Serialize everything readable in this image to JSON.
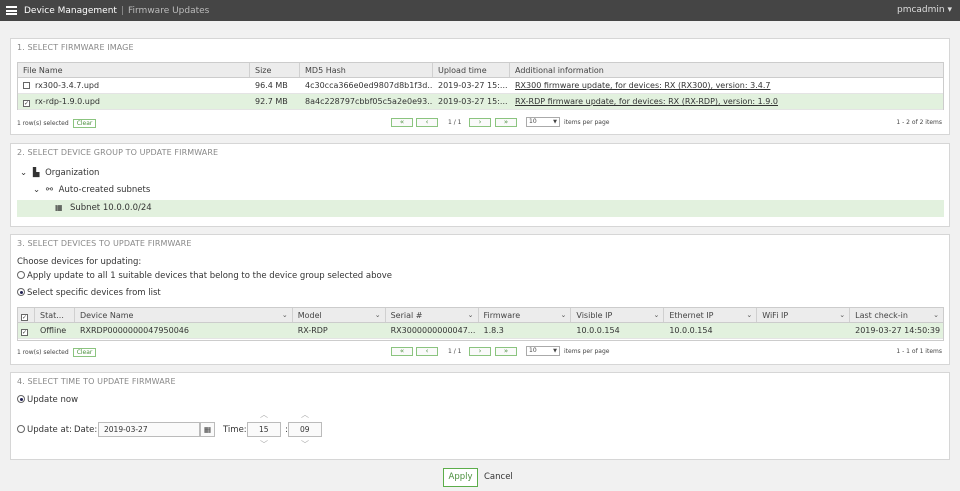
{
  "topbar": {
    "title": "Device Management",
    "separator": "|",
    "subtitle": "Firmware Updates",
    "user": "pmcadmin ▾"
  },
  "section1": {
    "title": "1. SELECT FIRMWARE IMAGE",
    "columns": [
      "File Name",
      "Size",
      "MD5 Hash",
      "Upload time",
      "Additional information"
    ],
    "rows": [
      {
        "name": "rx300-3.4.7.upd",
        "size": "96.4 MB",
        "md5": "4c30cca366e0ed9807d8b1f3d...",
        "time": "2019-03-27 15:...",
        "info": "RX300 firmware update, for devices: RX (RX300), version: 3.4.7",
        "selected": false
      },
      {
        "name": "rx-rdp-1.9.0.upd",
        "size": "92.7 MB",
        "md5": "8a4c228797cbbf05c5a2e0e93...",
        "time": "2019-03-27 15:...",
        "info": "RX-RDP firmware update, for devices: RX (RX-RDP), version: 1.9.0",
        "selected": true
      }
    ],
    "pager": {
      "selected": "1 row(s) selected",
      "clear": "Clear",
      "page": "1 / 1",
      "per_page_value": "10",
      "per_page_label": "items per page",
      "range": "1 - 2 of 2 items"
    }
  },
  "section2": {
    "title": "2. SELECT DEVICE GROUP TO UPDATE FIRMWARE",
    "org": "Organization",
    "auto": "Auto-created subnets",
    "subnet": "Subnet 10.0.0.0/24"
  },
  "section3": {
    "title": "3. SELECT DEVICES TO UPDATE FIRMWARE",
    "choose": "Choose devices for updating:",
    "opt_all": "Apply update to all 1 suitable devices that belong to the device group selected above",
    "opt_specific": "Select specific devices from list",
    "columns": [
      "Stat...",
      "Device Name",
      "Model",
      "Serial #",
      "Firmware",
      "Visible IP",
      "Ethernet IP",
      "WiFi IP",
      "Last check-in"
    ],
    "rows": [
      {
        "status": "Offline",
        "device": "RXRDP0000000047950046",
        "model": "RX-RDP",
        "serial": "RX3000000000047...",
        "firmware": "1.8.3",
        "visible_ip": "10.0.0.154",
        "eth_ip": "10.0.0.154",
        "wifi_ip": "",
        "last": "2019-03-27 14:50:39"
      }
    ],
    "pager": {
      "selected": "1 row(s) selected",
      "clear": "Clear",
      "page": "1 / 1",
      "per_page_value": "10",
      "per_page_label": "items per page",
      "range": "1 - 1 of 1 items"
    }
  },
  "section4": {
    "title": "4. SELECT TIME TO UPDATE FIRMWARE",
    "update_now": "Update now",
    "update_at": "Update at:",
    "date_label": "Date:",
    "date_value": "2019-03-27",
    "time_label": "Time:",
    "hour": "15",
    "colon": ":",
    "minute": "09"
  },
  "actions": {
    "apply": "Apply",
    "cancel": "Cancel"
  },
  "colors": {
    "selected_row": "#e2f1de",
    "accent_green": "#5cad4a",
    "topbar": "#454545"
  }
}
